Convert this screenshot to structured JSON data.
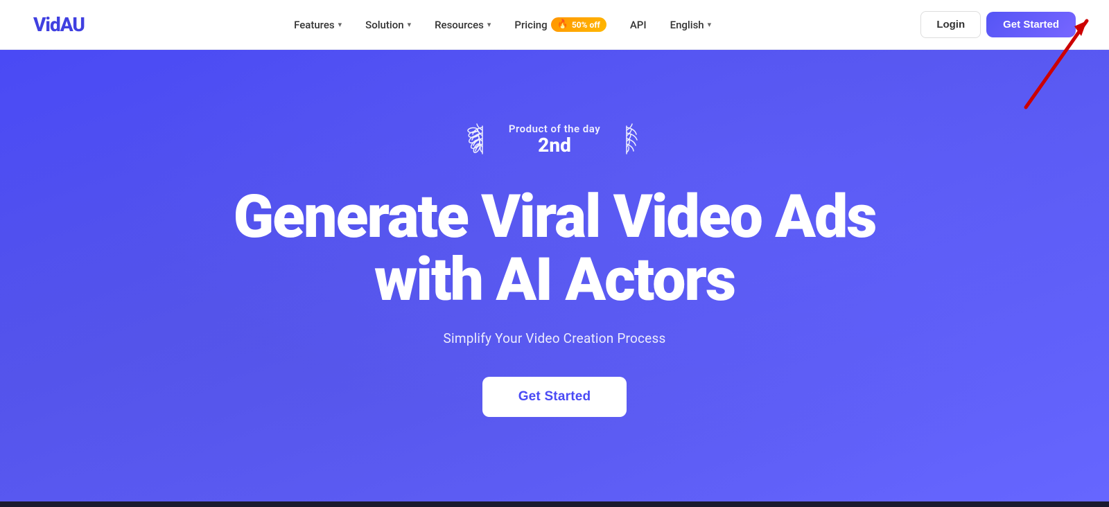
{
  "brand": {
    "logo": "VidAU"
  },
  "nav": {
    "links": [
      {
        "id": "features",
        "label": "Features",
        "hasDropdown": true
      },
      {
        "id": "solution",
        "label": "Solution",
        "hasDropdown": true
      },
      {
        "id": "resources",
        "label": "Resources",
        "hasDropdown": true
      },
      {
        "id": "pricing",
        "label": "Pricing",
        "hasDropdown": false,
        "badge": "🔥 50% off"
      },
      {
        "id": "api",
        "label": "API",
        "hasDropdown": false
      }
    ],
    "language": "English",
    "login_label": "Login",
    "get_started_label": "Get Started"
  },
  "hero": {
    "potd_label": "Product of the day",
    "potd_rank": "2nd",
    "headline_line1": "Generate Viral Video Ads",
    "headline_line2": "with AI Actors",
    "subheadline": "Simplify Your Video Creation Process",
    "cta_label": "Get Started"
  },
  "colors": {
    "brand_blue": "#4a4af5",
    "orange_badge": "#ff9500",
    "white": "#ffffff"
  }
}
